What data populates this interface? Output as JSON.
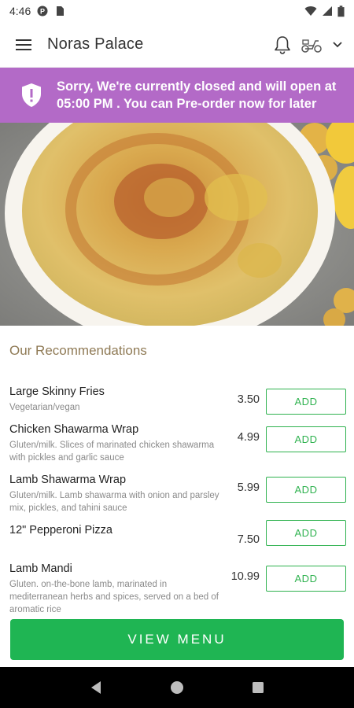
{
  "status_bar": {
    "time": "4:46",
    "icons": [
      "p-circle-icon",
      "sim-card-icon",
      "wifi-icon",
      "signal-icon",
      "battery-icon"
    ]
  },
  "app_bar": {
    "title": "Noras Palace",
    "icons": [
      "hamburger-menu-icon",
      "bell-icon",
      "scooter-icon",
      "chevron-down-icon"
    ]
  },
  "banner": {
    "line1": "Sorry, We're currently closed and will open at",
    "line2": "05:00 PM . You can Pre-order now for later",
    "color": "#b36ac7"
  },
  "recommendations": {
    "title": "Our Recommendations",
    "items": [
      {
        "name": "Large Skinny Fries",
        "desc": "Vegetarian/vegan",
        "price": "3.50",
        "add": "ADD"
      },
      {
        "name": "Chicken Shawarma Wrap",
        "desc": "Gluten/milk. Slices of marinated chicken shawarma with pickles and garlic sauce",
        "price": "4.99",
        "add": "ADD"
      },
      {
        "name": "Lamb Shawarma Wrap",
        "desc": "Gluten/milk. Lamb shawarma with onion and parsley mix, pickles, and tahini sauce",
        "price": "5.99",
        "add": "ADD"
      },
      {
        "name": "12\" Pepperoni Pizza",
        "desc": "",
        "price": "7.50",
        "add": "ADD"
      },
      {
        "name": "Lamb Mandi",
        "desc": "Gluten. on-the-bone lamb, marinated in mediterranean herbs and spices, served on a bed of aromatic rice",
        "price": "10.99",
        "add": "ADD"
      }
    ]
  },
  "view_menu": "VIEW MENU",
  "colors": {
    "accent_green": "#1fb553",
    "banner_purple": "#b36ac7",
    "section_title": "#8f7a55"
  }
}
